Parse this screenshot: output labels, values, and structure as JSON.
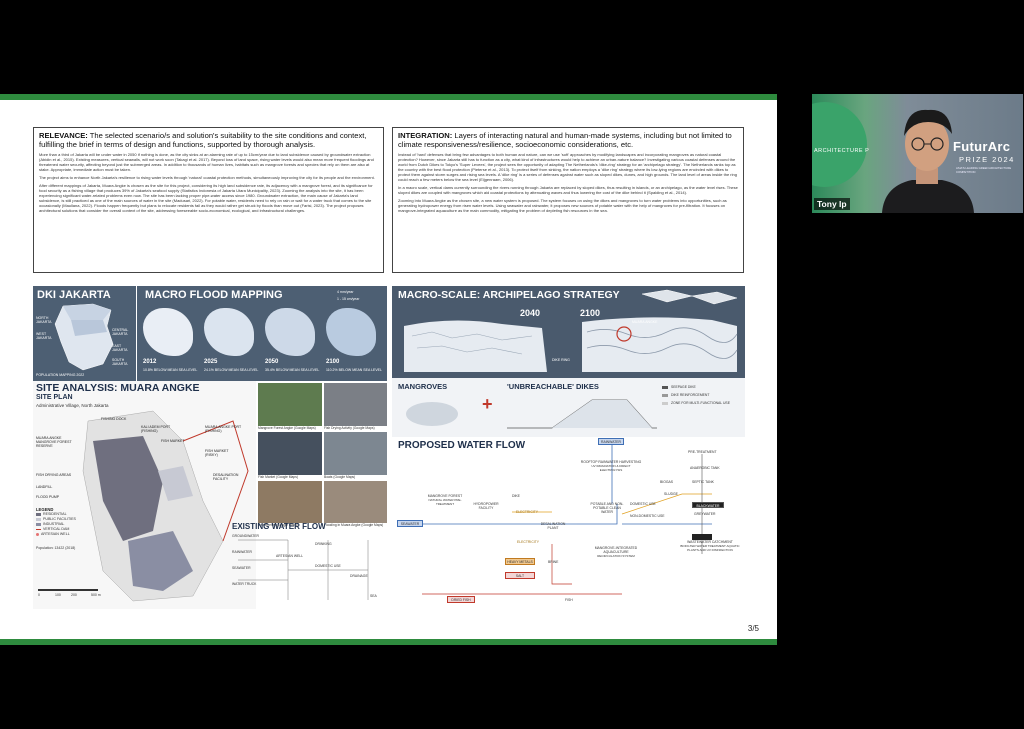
{
  "slide": {
    "relevance": {
      "heading": "RELEVANCE:",
      "heading_rest": "The selected scenario/s and solution's suitability to the site conditions and context, fulfilling the brief in terms of design and functions, supported by thorough analysis.",
      "para1": "More than a third of Jakarta will be under water in 2050 if nothing is done, as the city sinks at an alarming rate of up to 15cm/year due to land subsidence caused by groundwater extraction (Abidin et al., 2015). Existing measures, vertical seawalls, will not work soon (Takagi et al. 2017). Beyond loss of land space, rising water levels would also mean more frequent floodings and threatened water security, affecting beyond just the submerged areas. In addition to thousands of human lives, habitats such as mangrove forests and species that rely on them are also at stake. Appropriate, immediate action must be taken.",
      "para2": "The project aims to enhance North Jakarta's resilience to rising water levels through 'natural' coastal protection methods, simultaneously improving the city for its people and the environment.",
      "para3": "After different mappings of Jakarta, Muara Angke is chosen as the site for this project, considering its high land subsidence rate, its adjacency with a mangrove forest, and its significance for food security as a fishing village that produces 39% of Jakarta's seafood supply (Statistics Indonesia of Jakarta Utara Municipality, 2023). Zooming the analysis into the site, it has been experiencing significant water-related problems even now. The site has been lacking proper pipe-water access since 1980. Groundwater extraction, the main cause of Jakarta's land subsidence, is still practiced as one of the main sources of water in the site (Madusari, 2022). For potable water, residents need to rely on rain or wait for a water truck that comes to the site occasionally (Maullana, 2022). Floods happen frequently but plans to relocate residents fail as they would rather get struck by floods than move out (Farisi, 2023). The project proposes architectural solutions that consider the overall context of the site, addressing foreseeable socio-economical, ecological, and infrastructural challenges."
    },
    "integration": {
      "heading": "INTEGRATION:",
      "heading_rest": "Layers of interacting natural and human-made systems, including but not limited to climate responsiveness/resilience, socioeconomic considerations, etc.",
      "para1": "Instead of 'hard' defenses that bring few advantages to both human and nature, can we use 'soft' approaches by modifying landscapes and incorporating mangroves as natural coastal protection? However, since Jakarta still has to function as a city, what kind of infrastructures would help to achieve an urban-nature balance? Investigating various coastal defenses around the world from Dutch Dikes to Tokyo's 'Super Levees', the project sees the opportunity of adapting The Netherlands's 'dike-ring' strategy for an 'archipelago strategy'. The Netherlands ranks top as the country with the best flood protection (Pieterse et al., 2013). To protect itself from sinking, the nation employs a 'dike ring' strategy where its low-lying regions are encircled with dikes to protect them against storm surges and rising sea levels. A 'dike ring' is a series of defenses against water such as sloped dikes, dunes, and high grounds. The land level of areas inside the ring could reach a few meters below the sea level (Eijgenraam, 2006).",
      "para2": "In a macro scale, vertical dams currently surrounding the rivers running through Jakarta are replaced by sloped dikes, thus resulting in islands, or an archipelago, as the water level rises. These sloped dikes are coupled with mangroves which aid coastal protections by attenuating waves and thus lowering the cost of the dike behind it (Spalding et al., 2014).",
      "para3": "Zooming into Muara Angke as the chosen site, a new water system is proposed. The system focuses on using the dikes and mangroves to turn water problems into opportunities, such as generating hydropower energy from risen water levels. Using seawater and rainwater, it proposes new sources of potable water with the help of mangroves for pre-filtration. It focuses on mangrove-integrated aquaculture as the main commodity, mitigating the problem of depleting fish resources in the sea."
    },
    "dki": {
      "title": "DKI JAKARTA",
      "caption": "POPULATION MAPPING 2022",
      "labels": [
        "NORTH JAKARTA",
        "WEST JAKARTA",
        "CENTRAL JAKARTA",
        "EAST JAKARTA",
        "SOUTH JAKARTA"
      ]
    },
    "flood": {
      "title": "MACRO FLOOD MAPPING",
      "legend1": "4 mm/year",
      "legend2": "1 - 15 cm/year",
      "years": [
        "2012",
        "2025",
        "2050",
        "2100"
      ],
      "captions": [
        "10.8% BELOW MEAN SEA LEVEL",
        "24.1% BELOW MEAN SEA LEVEL",
        "35.4% BELOW MEAN SEA LEVEL",
        "110.2% BELOW MEAN SEA LEVEL"
      ]
    },
    "archipelago": {
      "title": "MACRO-SCALE: ARCHIPELAGO STRATEGY",
      "year1": "2040",
      "year2": "2100",
      "site_label": "MUARA ANGKE",
      "dike_label": "DIKE RING"
    },
    "mangroves": {
      "title1": "MANGROVES",
      "plus": "+",
      "title2": "'UNBREACHABLE' DIKES",
      "leg1": "SEEPAGE DIKE",
      "leg2": "DIKE REINFORCEMENT",
      "leg3": "ZONE FOR MULTI-FUNCTIONAL USE"
    },
    "site": {
      "title": "SITE ANALYSIS: MUARA ANGKE",
      "subtitle": "SITE PLAN",
      "location": "Administrative Village, North Jakarta",
      "labels": [
        "FISHING DOCK",
        "MUARA ANGKE MANGROVE FOREST RESERVE",
        "KALI ADEM PORT (FISHING)",
        "MUARA ANGKE PORT (FISHING)",
        "FISH MARKET",
        "FISH DRYING AREAS",
        "LANDFILL",
        "FLOOD PUMP",
        "FISH MARKET (RISKY)",
        "DESALINATION FACILITY"
      ],
      "legend_title": "LEGEND",
      "legend": [
        "RESIDENTIAL",
        "PUBLIC FACILITIES",
        "INDUSTRIAL",
        "VERTICAL DAM",
        "ARTESIAN WELL"
      ],
      "population": "Population: 13422 (2018)",
      "scale": [
        "0",
        "100",
        "200",
        "500 m"
      ]
    },
    "photos": {
      "captions": [
        "Mangrove Forest Angke (Google Maps)",
        "Fish Drying Activity (Google Maps)",
        "Fish Market (Google Maps)",
        "Boats (Google Maps)",
        "Settlements (Google Maps)",
        "Flooding in Muara Angke (Google Maps)"
      ]
    },
    "existing_flow": {
      "title": "EXISTING WATER FLOW",
      "nodes": [
        "GROUNDWATER",
        "RAINWATER",
        "SEAWATER",
        "WATER TRUCK",
        "ARTESIAN WELL",
        "DRINKING",
        "DOMESTIC USE",
        "DRAINAGE",
        "SEA"
      ]
    },
    "proposed_flow": {
      "title": "PROPOSED WATER FLOW",
      "nodes": {
        "rainwater": "RAINWATER",
        "rooftop": "ROOFTOP RAINWATER HARVESTING",
        "rooftop_sub": "UV IRRADIATION & DIRECT ELECTROLYSIS",
        "pretreat": "PRE-TREATMENT",
        "anaerobic": "ANAEROBIC TANK",
        "septic": "SEPTIC TANK",
        "blackwater": "BLACKWATER",
        "greywater": "GREYWATER",
        "mangrove": "MANGROVE FOREST",
        "mangrove_sub": "NATURAL WATER PRE-TREATMENT",
        "hydropower": "HYDROPOWER FACILITY",
        "dike": "DIKE",
        "electricity1": "ELECTRICITY",
        "electricity2": "ELECTRICITY",
        "seawater": "SEAWATER",
        "desal": "DESALINATION PLANT",
        "potable": "POTABLE AND NON-POTABLE CLEAN WATER",
        "domestic": "DOMESTIC USE",
        "nondomestic": "NON-DOMESTIC USE",
        "heavy": "HEAVY METALS",
        "brine": "BRINE",
        "salt": "SALT",
        "aquaculture": "MANGROVE-INTEGRATED AQUACULTURE",
        "aquaculture_sub": "RECIRCULATION SYSTEM",
        "wastewater": "WASTEWATER CATCHMENT",
        "wastewater_sub": "BIOFILTER WATER TREATMENT AQUATIC PLANTS AND UV DISINFECTION",
        "dried_fish": "DRIED FISH",
        "fish": "FISH",
        "biogas": "BIOGAS",
        "sludge": "SLUDGE"
      }
    },
    "page_number": "3/5"
  },
  "video": {
    "participant_name": "Tony Ip",
    "banner_left": "ARCHITECTURE P",
    "banner_brand": "FuturArc",
    "banner_prize": "PRIZE 2024",
    "banner_sub": "ASIA'S LEADING GREEN ARCHITECTURE COMPETITION"
  }
}
